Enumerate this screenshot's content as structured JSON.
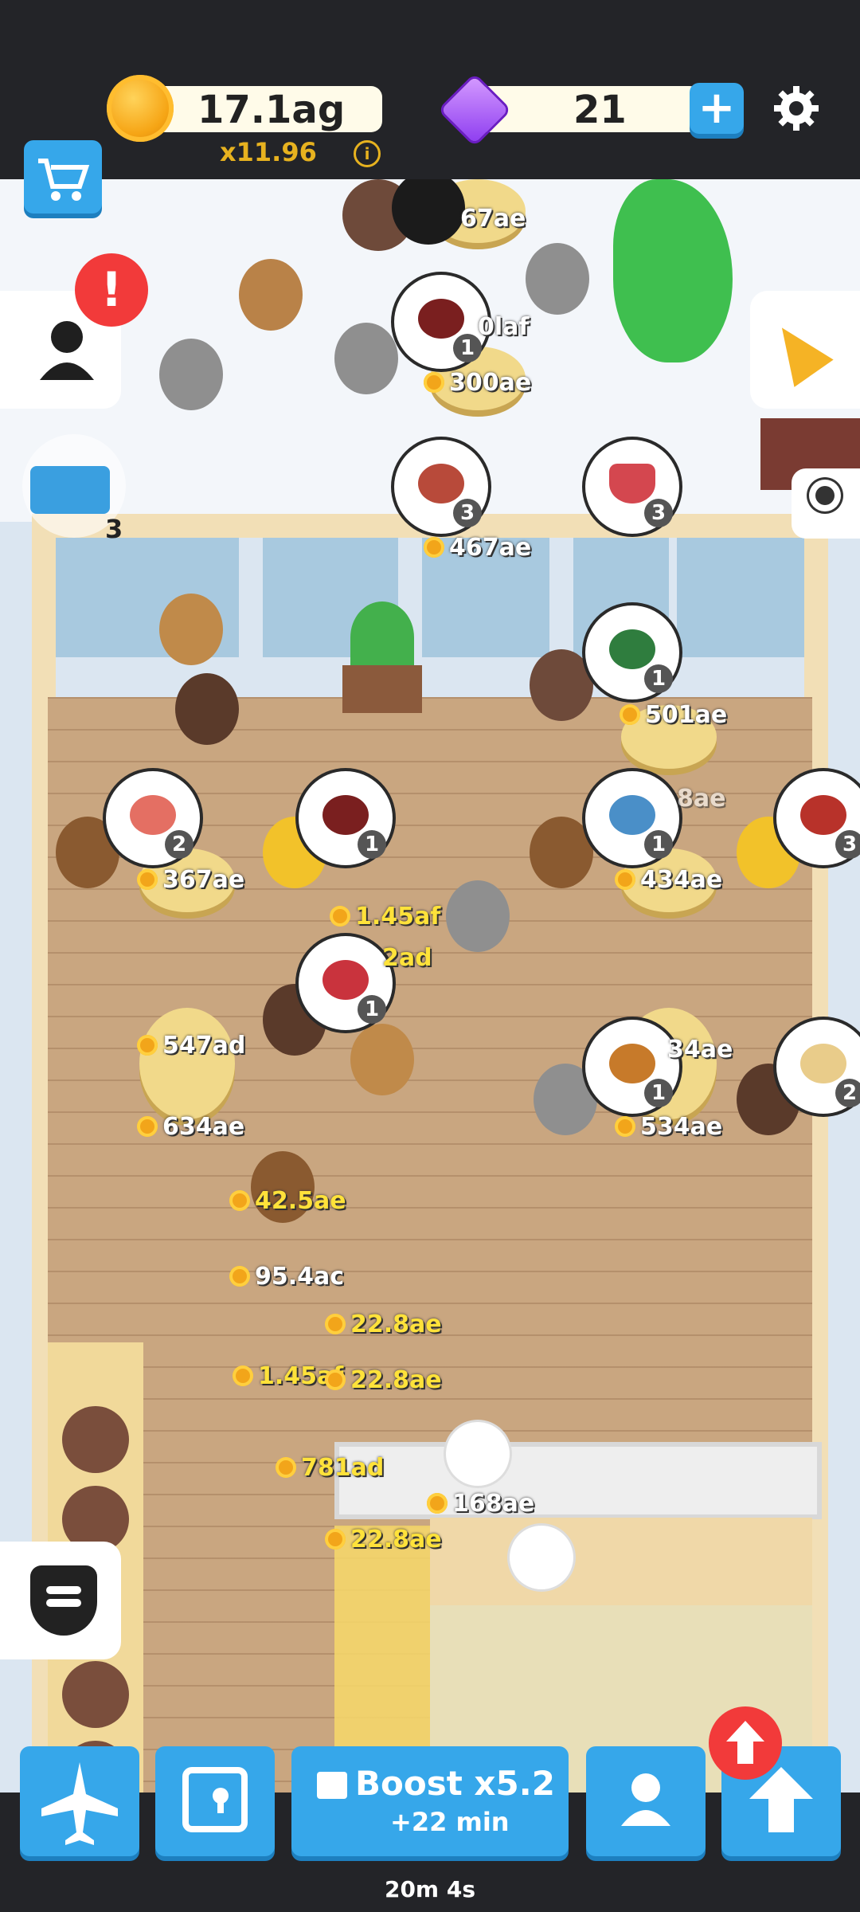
{
  "header": {
    "coins": "17.1ag",
    "multiplier": "x11.96",
    "info_icon": "info-icon",
    "gems": "21",
    "add_icon": "plus-icon",
    "settings_icon": "gear-icon",
    "shop_icon": "cart-icon"
  },
  "sidebar": {
    "profile_icon": "person-icon",
    "alert_badge": "!",
    "toolbox_count": "3",
    "event_icon": "party-popper-icon",
    "badge_icon": "ribbon-award-icon",
    "chef_icon": "burger-icon"
  },
  "scene": {
    "money_labels": [
      "67ae",
      "0laf",
      "300ae",
      "467ae",
      "501ae",
      "8ae",
      "367ae",
      "434ae",
      "1.45af",
      "2ad",
      "547ad",
      "34ae",
      "634ae",
      "534ae",
      "42.5ae",
      "95.4ac",
      "22.8ae",
      "1.45af",
      "22.8ae",
      "781ad",
      "168ae",
      "22.8ae"
    ],
    "order_bubbles": [
      {
        "item": "roast-chicken-icon",
        "count": "1"
      },
      {
        "item": "steak-fries-icon",
        "count": "3"
      },
      {
        "item": "wine-glass-icon",
        "count": "3"
      },
      {
        "item": "salad-icon",
        "count": "1"
      },
      {
        "item": "sushi-plate-icon",
        "count": "2"
      },
      {
        "item": "roast-chicken-icon",
        "count": "1"
      },
      {
        "item": "fish-plate-icon",
        "count": "1"
      },
      {
        "item": "lobster-icon",
        "count": "3"
      },
      {
        "item": "tomato-soup-icon",
        "count": "1"
      },
      {
        "item": "burger-icon",
        "count": "1"
      },
      {
        "item": "cake-slice-icon",
        "count": "2"
      }
    ]
  },
  "bottom_nav": {
    "travel_icon": "airplane-icon",
    "vault_icon": "safe-icon",
    "boost_label": "Boost x5.2",
    "boost_sub": "+22 min",
    "staff_icon": "person-icon",
    "upgrade_icon": "arrow-up-icon",
    "timer": "20m 4s"
  }
}
